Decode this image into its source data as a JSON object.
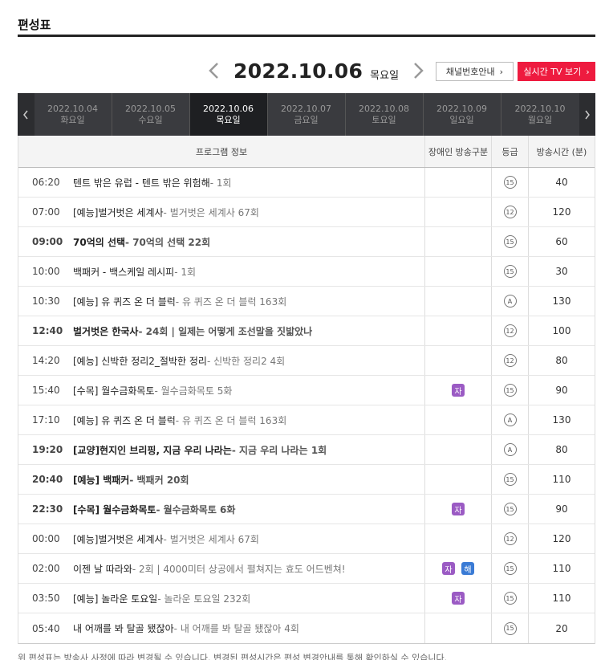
{
  "page": {
    "title": "편성표"
  },
  "date_nav": {
    "date": "2022.10.06",
    "dow": "목요일",
    "prev_icon": "chevron-left-icon",
    "next_icon": "chevron-right-icon"
  },
  "buttons": {
    "channel_label": "채널번호안내",
    "live_label": "실시간 TV 보기",
    "chevron": "›",
    "live_color": "#ee1b3f"
  },
  "tabs": [
    {
      "date": "2022.10.04",
      "dow": "화요일"
    },
    {
      "date": "2022.10.05",
      "dow": "수요일"
    },
    {
      "date": "2022.10.06",
      "dow": "목요일"
    },
    {
      "date": "2022.10.07",
      "dow": "금요일"
    },
    {
      "date": "2022.10.08",
      "dow": "토요일"
    },
    {
      "date": "2022.10.09",
      "dow": "일요일"
    },
    {
      "date": "2022.10.10",
      "dow": "월요일"
    }
  ],
  "active_tab": 2,
  "table": {
    "headers": {
      "info": "프로그램 정보",
      "disability": "장애인 방송구분",
      "grade": "등급",
      "minutes": "방송시간 (분)"
    },
    "badge_colors": {
      "자": "#9b5bc4",
      "해": "#3a7bd5"
    },
    "rows": [
      {
        "time": "06:20",
        "title": "텐트 밖은 유럽 - 텐트 밖은 위험해",
        "ep": " - 1회",
        "bold": false,
        "badges": [],
        "grade": "15",
        "minutes": "40"
      },
      {
        "time": "07:00",
        "title": "[예능]벌거벗은 세계사",
        "ep": " - 벌거벗은 세계사 67회",
        "bold": false,
        "badges": [],
        "grade": "12",
        "minutes": "120"
      },
      {
        "time": "09:00",
        "title": "70억의 선택",
        "ep": " - 70억의 선택 22회",
        "bold": true,
        "badges": [],
        "grade": "15",
        "minutes": "60"
      },
      {
        "time": "10:00",
        "title": "백패커 - 백스케일 레시피",
        "ep": " - 1회",
        "bold": false,
        "badges": [],
        "grade": "15",
        "minutes": "30"
      },
      {
        "time": "10:30",
        "title": "[예능] 유 퀴즈 온 더 블럭",
        "ep": " - 유 퀴즈 온 더 블럭 163회",
        "bold": false,
        "badges": [],
        "grade": "A",
        "minutes": "130"
      },
      {
        "time": "12:40",
        "title": "벌거벗은 한국사",
        "ep": " - 24회 | 일제는 어떻게 조선말을 짓밟았나",
        "bold": true,
        "badges": [],
        "grade": "12",
        "minutes": "100"
      },
      {
        "time": "14:20",
        "title": "[예능] 신박한 정리2_절박한 정리",
        "ep": " - 신박한 정리2 4회",
        "bold": false,
        "badges": [],
        "grade": "12",
        "minutes": "80"
      },
      {
        "time": "15:40",
        "title": "[수목] 월수금화목토",
        "ep": " - 월수금화목토 5화",
        "bold": false,
        "badges": [
          "자"
        ],
        "grade": "15",
        "minutes": "90"
      },
      {
        "time": "17:10",
        "title": "[예능] 유 퀴즈 온 더 블럭",
        "ep": " - 유 퀴즈 온 더 블럭 163회",
        "bold": false,
        "badges": [],
        "grade": "A",
        "minutes": "130"
      },
      {
        "time": "19:20",
        "title": "[교양]현지인 브리핑, 지금 우리 나라는",
        "ep": " - 지금 우리 나라는 1회",
        "bold": true,
        "badges": [],
        "grade": "A",
        "minutes": "80"
      },
      {
        "time": "20:40",
        "title": "[예능] 백패커",
        "ep": " - 백패커 20회",
        "bold": true,
        "badges": [],
        "grade": "15",
        "minutes": "110"
      },
      {
        "time": "22:30",
        "title": "[수목] 월수금화목토",
        "ep": " - 월수금화목토 6화",
        "bold": true,
        "badges": [
          "자"
        ],
        "grade": "15",
        "minutes": "90"
      },
      {
        "time": "00:00",
        "title": "[예능]벌거벗은 세계사",
        "ep": " - 벌거벗은 세계사 67회",
        "bold": false,
        "badges": [],
        "grade": "12",
        "minutes": "120"
      },
      {
        "time": "02:00",
        "title": "이젠 날 따라와",
        "ep": " - 2회 | 4000미터 상공에서 펼쳐지는 효도 어드벤쳐!",
        "bold": false,
        "badges": [
          "자",
          "해"
        ],
        "grade": "15",
        "minutes": "110"
      },
      {
        "time": "03:50",
        "title": "[예능] 놀라운 토요일",
        "ep": " - 놀라운 토요일 232회",
        "bold": false,
        "badges": [
          "자"
        ],
        "grade": "15",
        "minutes": "110"
      },
      {
        "time": "05:40",
        "title": "내 어깨를 봐 탈골 됐잖아",
        "ep": " - 내 어깨를 봐 탈골 됐잖아 4회",
        "bold": false,
        "badges": [],
        "grade": "15",
        "minutes": "20"
      }
    ]
  },
  "footer": {
    "note": "위 편성표는 방송사 사정에 따라 변경될 수 있습니다. 변경된 편성시간은 편성 변경안내를 통해 확인하실 수 있습니다."
  }
}
